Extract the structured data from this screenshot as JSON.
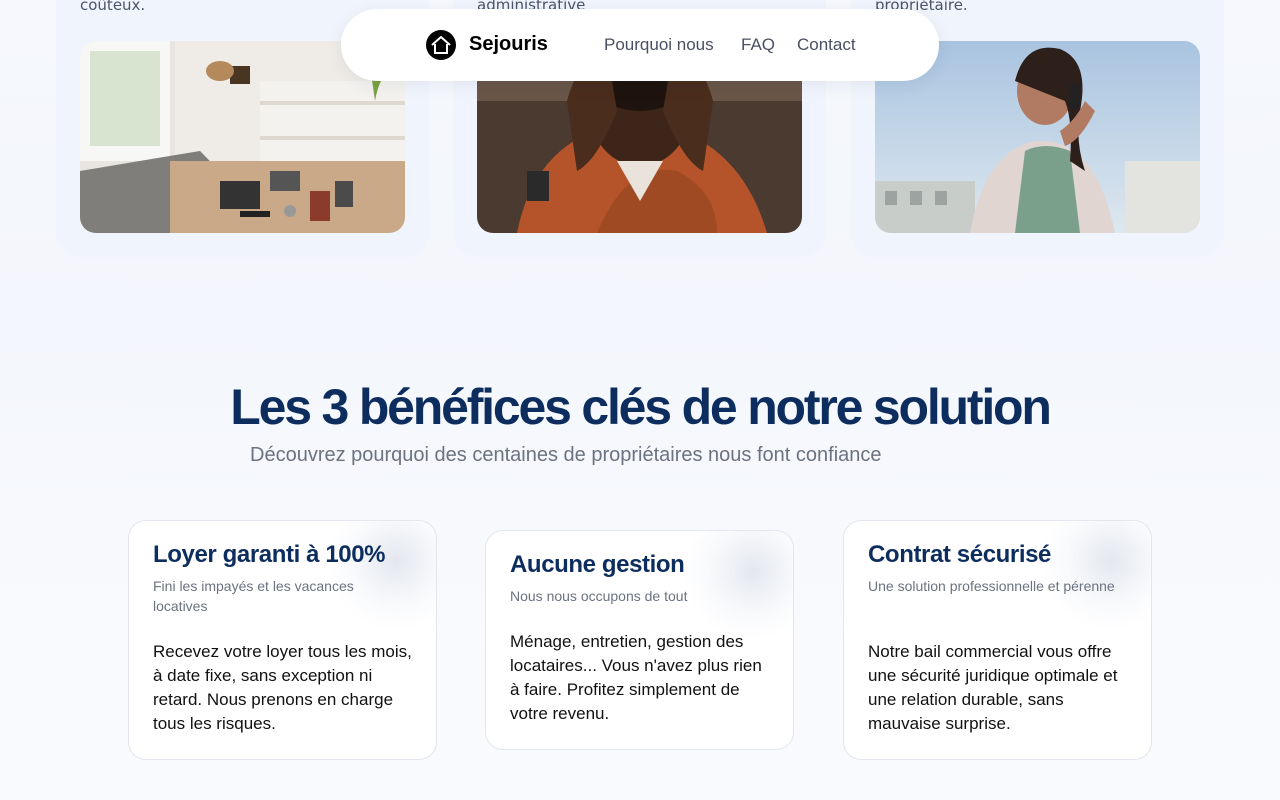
{
  "problems": [
    {
      "caption": "coûteux.",
      "image": "messy-apartment-photo"
    },
    {
      "caption": "administrative",
      "image": "stressed-man-photo"
    },
    {
      "caption": "propriétaire.",
      "image": "woman-on-phone-photo"
    }
  ],
  "nav": {
    "brand": "Sejouris",
    "logo_icon": "house-icon",
    "links": [
      "Pourquoi nous",
      "FAQ",
      "Contact"
    ]
  },
  "benefits_section": {
    "title": "Les 3 bénéfices clés de notre solution",
    "subtitle": "Découvrez pourquoi des centaines de propriétaires nous font confiance",
    "cards": [
      {
        "title": "Loyer garanti à 100%",
        "subtitle": "Fini les impayés et les vacances locatives",
        "body": "Recevez votre loyer tous les mois, à date fixe, sans exception ni retard. Nous prenons en charge tous les risques."
      },
      {
        "title": "Aucune gestion",
        "subtitle": "Nous nous occupons de tout",
        "body": "Ménage, entretien, gestion des locataires... Vous n'avez plus rien à faire. Profitez simplement de votre revenu."
      },
      {
        "title": "Contrat sécurisé",
        "subtitle": "Une solution professionnelle et pérenne",
        "body": "Notre bail commercial vous offre une sécurité juridique optimale et une relation durable, sans mauvaise surprise."
      }
    ]
  },
  "colors": {
    "heading": "#0d2d5e",
    "muted": "#6b7280",
    "card_bg": "#f0f4fc"
  }
}
